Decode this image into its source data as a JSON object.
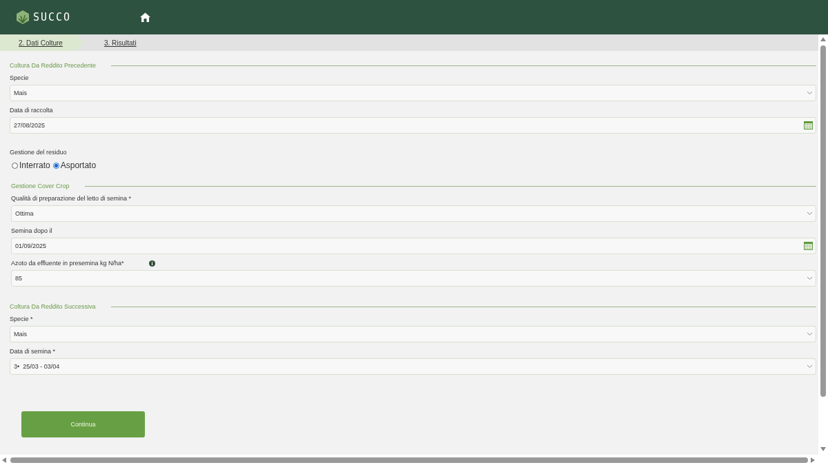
{
  "header": {
    "logo_text": "SUCCO"
  },
  "steps": [
    {
      "label": "2. Dati Colture",
      "selected": true
    },
    {
      "label": "3. Risultati",
      "selected": false
    }
  ],
  "sections": [
    {
      "title": "Coltura Da Reddito Precedente",
      "fields": [
        {
          "kind": "select",
          "label": "Specie",
          "value": "Mais"
        },
        {
          "kind": "date",
          "label": "Data di raccolta",
          "value": "27/08/2025"
        },
        {
          "kind": "radio",
          "label": "Gestione del residuo",
          "options": [
            {
              "label": "Interrato",
              "selected": false
            },
            {
              "label": "Asportato",
              "selected": true
            }
          ]
        }
      ]
    },
    {
      "title": "Gestione Cover Crop",
      "fields": [
        {
          "kind": "select",
          "label": "Qualità di preparazione del letto di semina *",
          "value": "Ottima"
        },
        {
          "kind": "date",
          "label": "Semina dopo il",
          "value": "01/09/2025"
        },
        {
          "kind": "select",
          "label": "Azoto da effluente in presemina kg N/ha*",
          "value": "85",
          "info": true
        }
      ]
    },
    {
      "title": "Coltura Da Reddito Successiva",
      "fields": [
        {
          "kind": "select",
          "label": "Specie *",
          "value": "Mais"
        },
        {
          "kind": "select",
          "label": "Data di semina *",
          "value": "3•  25/03 - 03/04"
        }
      ]
    }
  ],
  "continue_button": "Continua"
}
